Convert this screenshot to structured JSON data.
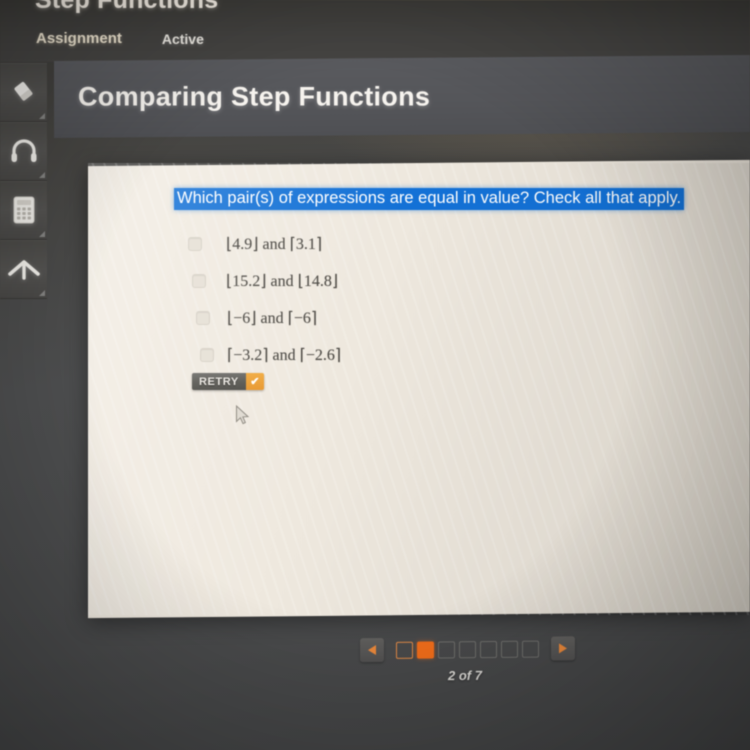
{
  "app": {
    "course_title": "Step Functions",
    "meta": {
      "assignment_label": "Assignment",
      "status_label": "Active"
    }
  },
  "toolbar": {
    "tools": [
      {
        "name": "eraser-icon",
        "label": "Eraser"
      },
      {
        "name": "headphones-icon",
        "label": "Audio"
      },
      {
        "name": "calculator-icon",
        "label": "Calculator"
      },
      {
        "name": "chevron-up-icon",
        "label": "Collapse"
      }
    ]
  },
  "header": {
    "title": "Comparing Step Functions"
  },
  "question": {
    "prompt": "Which pair(s) of expressions are equal in value? Check all that apply.",
    "options": [
      {
        "text": "⌊4.9⌋ and ⌈3.1⌉",
        "checked": false
      },
      {
        "text": "⌊15.2⌋ and ⌊14.8⌋",
        "checked": false
      },
      {
        "text": "⌊−6⌋ and ⌈−6⌉",
        "checked": false
      },
      {
        "text": "⌈−3.2⌉ and ⌈−2.6⌉",
        "checked": false
      }
    ]
  },
  "retry_button": {
    "label": "RETRY",
    "check_glyph": "✔",
    "accent_color": "#e8952a"
  },
  "pagination": {
    "prev_label": "◀",
    "next_label": "▶",
    "total_slides": 7,
    "current_slide": 2,
    "count_text": "2 of 7",
    "current_color": "#ef6c1a"
  },
  "colors": {
    "highlight_blue": "#1371d6",
    "panel_background": "#efe9df",
    "chrome_dark": "#434240"
  }
}
